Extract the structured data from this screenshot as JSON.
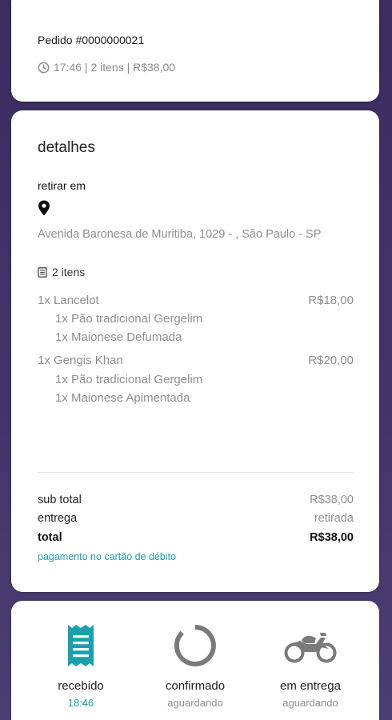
{
  "order": {
    "title": "Pedido #0000000021",
    "meta": "17:46 | 2 itens | R$38,00"
  },
  "details": {
    "title": "detalhes",
    "pickup_label": "retirar em",
    "address": "Avenida Baronesa de Muritiba, 1029 - , São Paulo - SP",
    "items_count": "2 itens",
    "items": [
      {
        "name": "1x Lancelot",
        "price": "R$18,00",
        "options": [
          "1x Pão tradicional Gergelim",
          "1x Maionese Defumada"
        ]
      },
      {
        "name": "1x Gengis Khan",
        "price": "R$20,00",
        "options": [
          "1x Pão tradicional Gergelim",
          "1x Maionese Apimentada"
        ]
      }
    ],
    "summary": {
      "subtotal_label": "sub total",
      "subtotal_value": "R$38,00",
      "delivery_label": "entrega",
      "delivery_value": "retirada",
      "total_label": "total",
      "total_value": "R$38,00"
    },
    "payment": "pagamento no cartão de débito"
  },
  "status": {
    "steps": [
      {
        "label": "recebido",
        "sub": "18:46",
        "icon": "receipt-icon"
      },
      {
        "label": "confirmado",
        "sub": "aguardando",
        "icon": "loading-circle-icon"
      },
      {
        "label": "em entrega",
        "sub": "aguardando",
        "icon": "motorcycle-icon"
      }
    ]
  },
  "colors": {
    "background": "#3d2f63",
    "accent": "#1aa0ad",
    "muted": "#8e8e8e"
  }
}
